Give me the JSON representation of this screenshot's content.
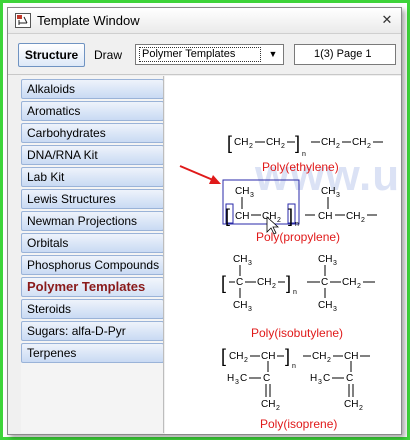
{
  "window": {
    "title": "Template Window",
    "close_glyph": "✕"
  },
  "toolbar": {
    "structure_tab": "Structure",
    "draw_tab": "Draw",
    "template_select": "Polymer Templates",
    "select_arrow": "▼",
    "page_select": "1(3) Page 1"
  },
  "sidebar": {
    "items": [
      {
        "label": "Alkaloids"
      },
      {
        "label": "Aromatics"
      },
      {
        "label": "Carbohydrates"
      },
      {
        "label": "DNA/RNA Kit"
      },
      {
        "label": "Lab Kit"
      },
      {
        "label": "Lewis Structures"
      },
      {
        "label": "Newman Projections"
      },
      {
        "label": "Orbitals"
      },
      {
        "label": "Phosphorus Compounds"
      },
      {
        "label": "Polymer Templates",
        "selected": true
      },
      {
        "label": "Steroids"
      },
      {
        "label": "Sugars: alfa-D-Pyr"
      },
      {
        "label": "Terpenes"
      }
    ]
  },
  "watermark": "www.urip.info",
  "templates": [
    {
      "name": "Poly(ethylene)"
    },
    {
      "name": "Poly(propylene)"
    },
    {
      "name": "Poly(isobutylene)"
    },
    {
      "name": "Poly(isoprene)"
    }
  ],
  "chem": {
    "ch": "CH",
    "ch2": "CH",
    "ch3": "CH",
    "c": "C",
    "h3c": "H",
    "sub2": "2",
    "sub3": "3",
    "n": "n",
    "dash": "–"
  },
  "colors": {
    "accent_green": "#3ed43a",
    "selected_red": "#8a1a1a",
    "label_red": "#e01a1a",
    "selection_blue": "#2a2aa8",
    "arrow_red": "#e01a1a"
  },
  "icons": {
    "app": "molecule-window-icon",
    "close": "close-icon",
    "dropdown": "chevron-down-icon",
    "pointer": "red-arrow-pointer-icon",
    "cursor": "mouse-cursor-icon"
  }
}
